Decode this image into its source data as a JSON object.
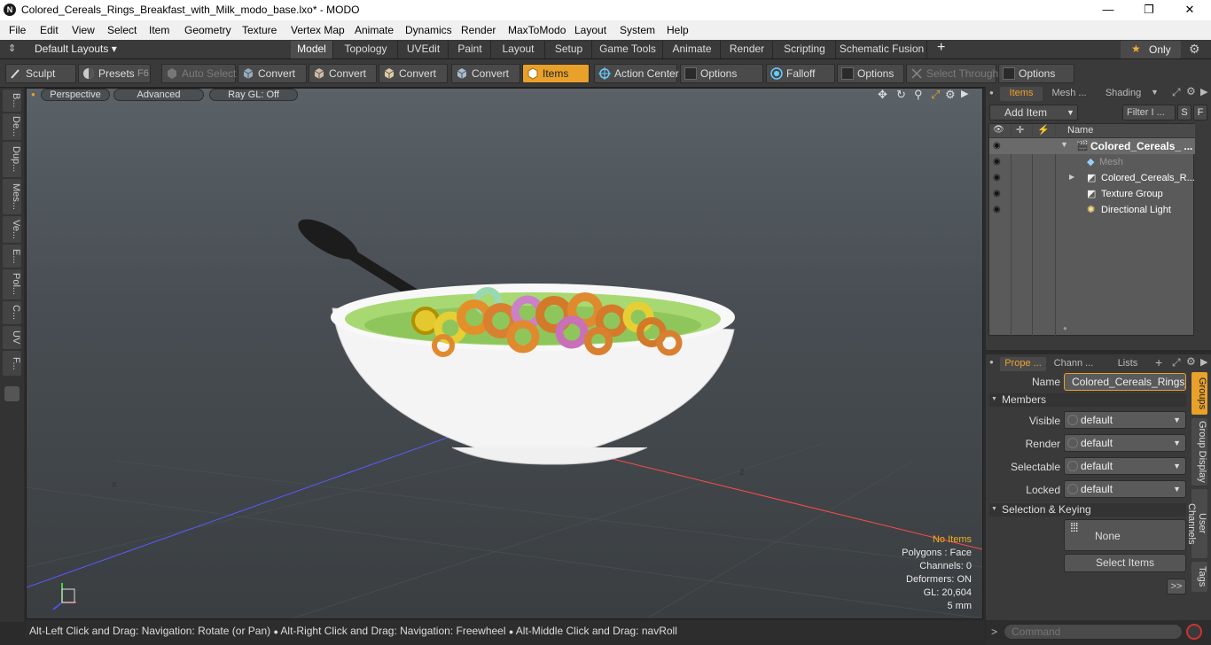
{
  "window": {
    "title": "Colored_Cereals_Rings_Breakfast_with_Milk_modo_base.lxo* - MODO",
    "app_icon": "N",
    "minimize": "—",
    "maximize": "❐",
    "close": "✕"
  },
  "menu": [
    "File",
    "Edit",
    "View",
    "Select",
    "Item",
    "Geometry",
    "Texture",
    "Vertex Map",
    "Animate",
    "Dynamics",
    "Render",
    "MaxToModo",
    "Layout",
    "System",
    "Help"
  ],
  "layout": {
    "selector": "Default Layouts",
    "tabs": [
      "Model",
      "Topology",
      "UVEdit",
      "Paint",
      "Layout",
      "Setup",
      "Game Tools",
      "Animate",
      "Render",
      "Scripting",
      "Schematic Fusion"
    ],
    "active_tab": "Model",
    "add": "+",
    "only": "Only",
    "star": "★"
  },
  "toolbar": {
    "sculpt": "Sculpt",
    "presets": "Presets",
    "presets_key": "F6",
    "auto_select": "Auto Select",
    "convert1": "Convert",
    "convert2": "Convert",
    "convert3": "Convert",
    "convert4": "Convert",
    "items": "Items",
    "action_center": "Action Center",
    "options1": "Options",
    "falloff": "Falloff",
    "options2": "Options",
    "select_through": "Select Through",
    "options3": "Options"
  },
  "left_tabs": [
    "B...",
    "De...",
    "Dup...",
    "Mes...",
    "Ve...",
    "E...",
    "Pol...",
    "C...",
    "UV",
    "F..."
  ],
  "viewport": {
    "perspective": "Perspective",
    "advanced": "Advanced",
    "raygl": "Ray GL: Off",
    "info": {
      "no_items": "No Items",
      "polygons": "Polygons : Face",
      "channels": "Channels: 0",
      "deformers": "Deformers: ON",
      "gl": "GL: 20,604",
      "unit": "5 mm"
    },
    "axis_x": "x",
    "axis_z": "z"
  },
  "status": {
    "hint1": "Alt-Left Click and Drag: Navigation: Rotate (or Pan)",
    "hint2": "Alt-Right Click and Drag: Navigation: Freewheel",
    "hint3": "Alt-Middle Click and Drag: navRoll"
  },
  "items_panel": {
    "tabs": [
      "Items",
      "Mesh ...",
      "Shading"
    ],
    "add_item": "Add Item",
    "filter": "Filter I ...",
    "s_btn": "S",
    "f_btn": "F",
    "col_name": "Name",
    "rows": [
      {
        "name": "Colored_Cereals_ ...",
        "bold": true
      },
      {
        "name": "Mesh",
        "dim": true
      },
      {
        "name": "Colored_Cereals_R..."
      },
      {
        "name": "Texture Group"
      },
      {
        "name": "Directional Light"
      }
    ]
  },
  "props_panel": {
    "tabs": [
      "Prope ...",
      "Chann ...",
      "Lists"
    ],
    "add": "+",
    "name_label": "Name",
    "name_value": "Colored_Cereals_Rings_Br",
    "members": "Members",
    "visible_label": "Visible",
    "render_label": "Render",
    "selectable_label": "Selectable",
    "locked_label": "Locked",
    "default": "default",
    "sel_keying": "Selection & Keying",
    "none": "None",
    "select_items": "Select Items",
    "more": ">>",
    "side_tabs": [
      "Groups",
      "Group Display",
      "User Channels",
      "Tags"
    ]
  },
  "command": {
    "placeholder": "Command",
    "arrow": ">"
  }
}
